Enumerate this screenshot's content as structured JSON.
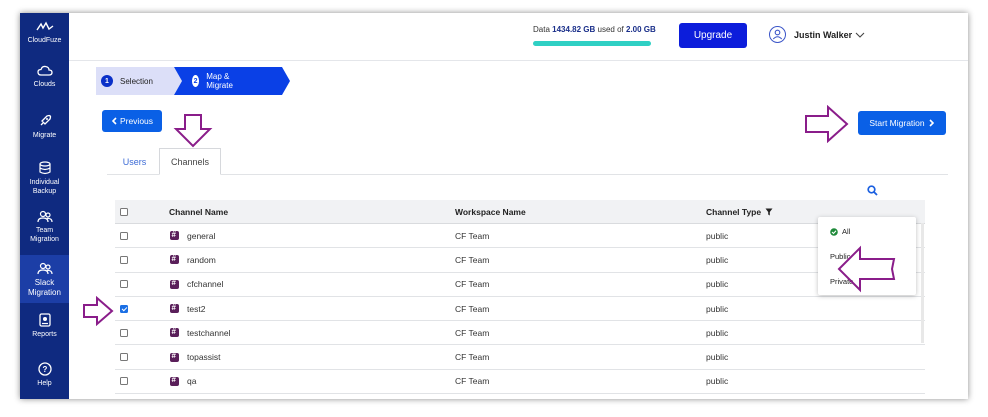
{
  "sidebar": {
    "brand": "CloudFuze",
    "items": [
      {
        "label": "Clouds",
        "icon": "cloud-icon"
      },
      {
        "label": "Migrate",
        "icon": "rocket-icon"
      },
      {
        "label_line1": "Individual",
        "label_line2": "Backup",
        "icon": "database-icon"
      },
      {
        "label_line1": "Team",
        "label_line2": "Migration",
        "icon": "team-icon"
      },
      {
        "label_line1": "Slack",
        "label_line2": "Migration",
        "icon": "team-icon",
        "active": true
      },
      {
        "label": "Reports",
        "icon": "report-icon"
      },
      {
        "label": "Help",
        "icon": "help-icon"
      }
    ]
  },
  "header": {
    "usage_prefix": "Data",
    "usage_used": "1434.82 GB",
    "usage_mid": "used of",
    "usage_total": "2.00 GB",
    "usage_fraction": 1.0,
    "upgrade_label": "Upgrade",
    "user_name": "Justin Walker"
  },
  "steps": [
    {
      "num": "1",
      "label": "Selection"
    },
    {
      "num": "2",
      "label": "Map & Migrate"
    }
  ],
  "actions": {
    "previous_label": "Previous",
    "start_label": "Start Migration"
  },
  "tabs": [
    {
      "label": "Users"
    },
    {
      "label": "Channels",
      "active": true
    }
  ],
  "table": {
    "columns": [
      "Channel Name",
      "Workspace Name",
      "Channel Type"
    ],
    "rows": [
      {
        "name": "general",
        "workspace": "CF Team",
        "type": "public",
        "checked": false
      },
      {
        "name": "random",
        "workspace": "CF Team",
        "type": "public",
        "checked": false
      },
      {
        "name": "cfchannel",
        "workspace": "CF Team",
        "type": "public",
        "checked": false
      },
      {
        "name": "test2",
        "workspace": "CF Team",
        "type": "public",
        "checked": true
      },
      {
        "name": "testchannel",
        "workspace": "CF Team",
        "type": "public",
        "checked": false
      },
      {
        "name": "topassist",
        "workspace": "CF Team",
        "type": "public",
        "checked": false
      },
      {
        "name": "qa",
        "workspace": "CF Team",
        "type": "public",
        "checked": false
      }
    ]
  },
  "filter_menu": {
    "options": [
      "All",
      "Public",
      "Private"
    ],
    "selected": "All"
  },
  "colors": {
    "sidebar": "#0f2a80",
    "primary": "#0a60e6",
    "annotation_arrow": "#8a1d8a"
  }
}
